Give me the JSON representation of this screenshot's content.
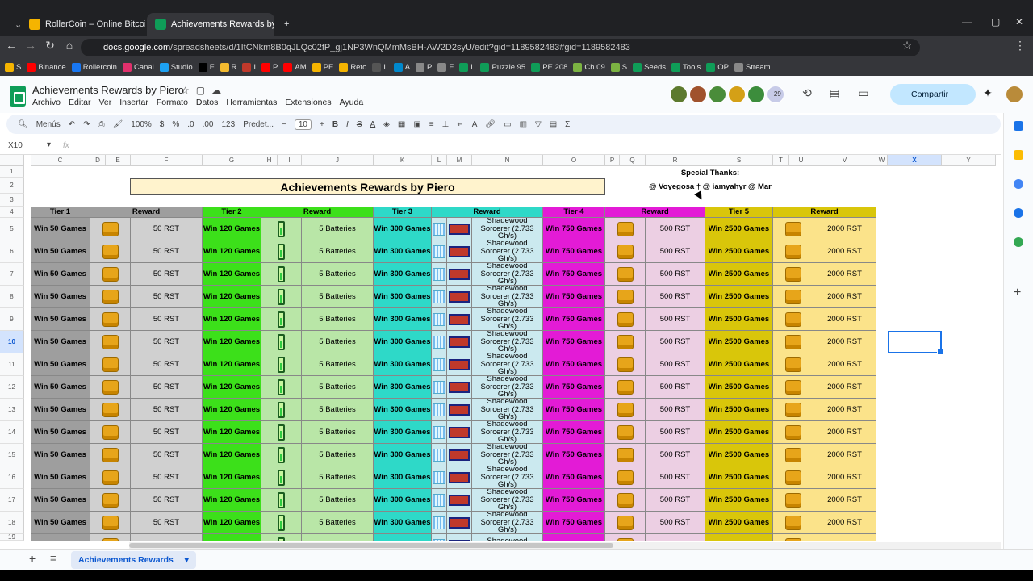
{
  "browser": {
    "tabs": [
      {
        "label": "RollerCoin – Online Bitcoin Min",
        "color": "#f5b400"
      },
      {
        "label": "Achievements Rewards by Piero",
        "color": "#0f9d58"
      }
    ],
    "url_prefix": "docs.google.com",
    "url_rest": "/spreadsheets/d/1ItCNkm8B0qJLQc02fP_gj1NP3WnQMmMsBH-AW2D2syU/edit?gid=1189582483#gid=1189582483",
    "bookmarks": [
      "S",
      "Binance",
      "Rollercoin",
      "Canal",
      "Studio",
      "F",
      "R",
      "I",
      "P",
      "AM",
      "PE",
      "Reto",
      "L",
      "A",
      "P",
      "F",
      "L",
      "Puzzle 95",
      "PE 208",
      "Ch 09",
      "S",
      "Seeds",
      "Tools",
      "OP",
      "Stream"
    ]
  },
  "doc": {
    "title": "Achievements Rewards by Piero",
    "menu": [
      "Archivo",
      "Editar",
      "Ver",
      "Insertar",
      "Formato",
      "Datos",
      "Herramientas",
      "Extensiones",
      "Ayuda"
    ],
    "share_label": "Compartir",
    "collaborators_more": "+29"
  },
  "toolbar": {
    "search": "Menús",
    "zoom": "100%",
    "currency": "$",
    "percent": "%",
    "dec_less": ".0",
    "dec_more": ".00",
    "number_fmt": "123",
    "font": "Predet...",
    "font_size": "10"
  },
  "formula_bar": {
    "cell_ref": "X10",
    "fx": "fx",
    "value": ""
  },
  "columns": [
    "C",
    "D",
    "E",
    "F",
    "G",
    "H",
    "I",
    "J",
    "K",
    "L",
    "M",
    "N",
    "O",
    "P",
    "Q",
    "R",
    "S",
    "T",
    "U",
    "V",
    "W",
    "X",
    "Y"
  ],
  "selected_column": "X",
  "rows": [
    "1",
    "2",
    "3",
    "4",
    "5",
    "6",
    "7",
    "8",
    "9",
    "10",
    "11",
    "12",
    "13",
    "14",
    "15",
    "16",
    "17",
    "18",
    "19"
  ],
  "selected_row": "10",
  "sheet": {
    "title": "Achievements Rewards by Piero",
    "special_thanks": "Special Thanks:",
    "thanks_names": "@ Voyegosa † @ iamyahyr @ Mar",
    "headers": [
      "Tier 1",
      "Reward",
      "Tier 2",
      "Reward",
      "Tier 3",
      "Reward",
      "Tier 4",
      "Reward",
      "Tier 5",
      "Reward"
    ],
    "colors": {
      "tier1": "#9e9e9e",
      "reward1": "#d0d0d0",
      "tier2": "#3ce01a",
      "reward2": "#b9e6a7",
      "tier3": "#2ed9c8",
      "reward3": "#cbe9ef",
      "tier4": "#e31bd6",
      "reward4": "#eccfe3",
      "tier5": "#d9c60a",
      "reward5": "#fbe38a"
    },
    "row_values": {
      "tier1": "Win 50 Games",
      "reward1": "50 RST",
      "tier2": "Win 120 Games",
      "reward2": "5 Batteries",
      "tier3": "Win 300 Games",
      "reward3": "Shadewood Sorcerer (2.733 Gh/s)",
      "tier4": "Win 750 Games",
      "reward4": "500 RST",
      "tier5": "Win 2500 Games",
      "reward5": "2000 RST"
    },
    "data_row_count": 14,
    "partial_reward3": "Shadewood Sorcerer"
  },
  "sheet_tab": "Achievements Rewards"
}
